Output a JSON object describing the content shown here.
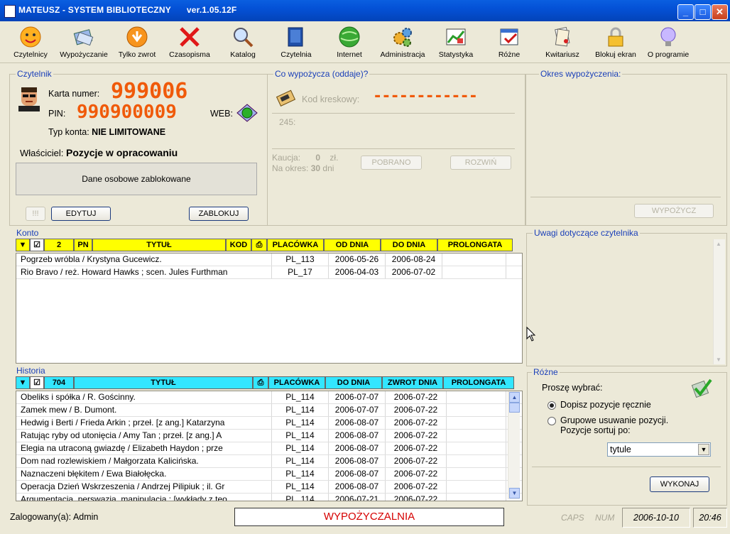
{
  "window": {
    "title": "MATEUSZ - SYSTEM BIBLIOTECZNY",
    "version": "ver.1.05.12F"
  },
  "toolbar": [
    {
      "label": "Czytelnicy",
      "icon": "smiley-icon"
    },
    {
      "label": "Wypożyczanie",
      "icon": "book-loan-icon"
    },
    {
      "label": "Tylko zwrot",
      "icon": "return-arrow-icon"
    },
    {
      "label": "Czasopisma",
      "icon": "red-x-icon"
    },
    {
      "label": "Katalog",
      "icon": "magnifier-icon"
    },
    {
      "label": "Czytelnia",
      "icon": "reading-book-icon"
    },
    {
      "label": "Internet",
      "icon": "globe-icon"
    },
    {
      "label": "Administracja",
      "icon": "gears-icon"
    },
    {
      "label": "Statystyka",
      "icon": "chart-icon"
    },
    {
      "label": "Różne",
      "icon": "calendar-check-icon"
    },
    {
      "label": "Kwitariusz",
      "icon": "receipts-icon"
    },
    {
      "label": "Blokuj ekran",
      "icon": "padlock-icon"
    },
    {
      "label": "O programie",
      "icon": "lightbulb-icon"
    }
  ],
  "reader": {
    "section_title": "Czytelnik",
    "card_label": "Karta numer:",
    "card_number": "999006",
    "pin_label": "PIN:",
    "pin": "990900009",
    "web_label": "WEB:",
    "account_type_label": "Typ konta:",
    "account_type": "NIE LIMITOWANE",
    "owner_label": "Właściciel:",
    "owner": "Pozycje w opracowaniu",
    "personal_data_note": "Dane osobowe zablokowane",
    "btn_alert": "!!!",
    "btn_edit": "EDYTUJ",
    "btn_block": "ZABLOKUJ"
  },
  "loan": {
    "section_title": "Co wypożycza (oddaje)?",
    "barcode_label": "Kod kreskowy:",
    "barcode_value": "------------",
    "code_hint": "245:",
    "deposit_label": "Kaucja:",
    "deposit_value": "0",
    "deposit_unit": "zł.",
    "period_label": "Na okres:",
    "period_value": "30",
    "period_unit": "dni",
    "btn_collected": "POBRANO",
    "btn_expand": "ROZWIŃ"
  },
  "period": {
    "section_title": "Okres wypożyczenia:",
    "btn_lend": "WYPOŻYCZ"
  },
  "account": {
    "section_title": "Konto",
    "count": "2",
    "headers": {
      "pn": "PN",
      "title": "TYTUŁ",
      "kod": "KOD",
      "branch": "PLACÓWKA",
      "from": "OD DNIA",
      "to": "DO DNIA",
      "prolong": "PROLONGATA"
    },
    "rows": [
      {
        "title": "Pogrzeb wróbla /   Krystyna Gucewicz.",
        "branch": "PL_113",
        "from": "2006-05-26",
        "to": "2006-08-24",
        "prolong": ""
      },
      {
        "title": "Rio Bravo /   reż. Howard Hawks ; scen. Jules Furthman",
        "branch": "PL_17",
        "from": "2006-04-03",
        "to": "2006-07-02",
        "prolong": ""
      }
    ]
  },
  "remarks": {
    "section_title": "Uwagi dotyczące czytelnika"
  },
  "history": {
    "section_title": "Historia",
    "count": "704",
    "headers": {
      "title": "TYTUŁ",
      "branch": "PLACÓWKA",
      "to": "DO DNIA",
      "returned": "ZWROT DNIA",
      "prolong": "PROLONGATA"
    },
    "rows": [
      {
        "title": "Obeliks i spółka /   R. Gościnny.",
        "branch": "PL_114",
        "to": "2006-07-07",
        "returned": "2006-07-22",
        "prolong": ""
      },
      {
        "title": "Zamek mew /   B. Dumont.",
        "branch": "PL_114",
        "to": "2006-07-07",
        "returned": "2006-07-22",
        "prolong": ""
      },
      {
        "title": "Hedwig i Berti /   Frieda Arkin ; przeł. [z ang.] Katarzyna",
        "branch": "PL_114",
        "to": "2006-08-07",
        "returned": "2006-07-22",
        "prolong": ""
      },
      {
        "title": "Ratując ryby od utonięcia /   Amy Tan ; przeł. [z ang.] A",
        "branch": "PL_114",
        "to": "2006-08-07",
        "returned": "2006-07-22",
        "prolong": ""
      },
      {
        "title": "Elegia na utraconą gwiazdę /   Elizabeth Haydon ; prze",
        "branch": "PL_114",
        "to": "2006-08-07",
        "returned": "2006-07-22",
        "prolong": ""
      },
      {
        "title": "Dom nad rozlewiskiem /   Małgorzata Kalicińska.",
        "branch": "PL_114",
        "to": "2006-08-07",
        "returned": "2006-07-22",
        "prolong": ""
      },
      {
        "title": "Naznaczeni błękitem /   Ewa Białołęcka.",
        "branch": "PL_114",
        "to": "2006-08-07",
        "returned": "2006-07-22",
        "prolong": ""
      },
      {
        "title": "Operacja Dzień Wskrzeszenia /   Andrzej Pilipiuk ; il. Gr",
        "branch": "PL_114",
        "to": "2006-08-07",
        "returned": "2006-07-22",
        "prolong": ""
      },
      {
        "title": "Argumentacja, perswazja, manipulacja : [wykłady z teo",
        "branch": "PL_114",
        "to": "2006-07-21",
        "returned": "2006-07-22",
        "prolong": ""
      }
    ]
  },
  "misc": {
    "section_title": "Różne",
    "prompt": "Proszę wybrać:",
    "option_manual": "Dopisz pozycje ręcznie",
    "option_group_1": "Grupowe usuwanie pozycji.",
    "option_group_2": "Pozycje sortuj po:",
    "sort_selected": "tytule",
    "btn_execute": "WYKONAJ"
  },
  "status": {
    "logged_label": "Zalogowany(a):",
    "logged_user": "Admin",
    "mode": "WYPOŻYCZALNIA",
    "caps": "CAPS",
    "num": "NUM",
    "date": "2006-10-10",
    "time": "20:46"
  },
  "colors": {
    "account_header": "#ffff00",
    "history_header": "#33e6ff",
    "led": "#f05a0a",
    "accent": "#1a3fb8"
  }
}
